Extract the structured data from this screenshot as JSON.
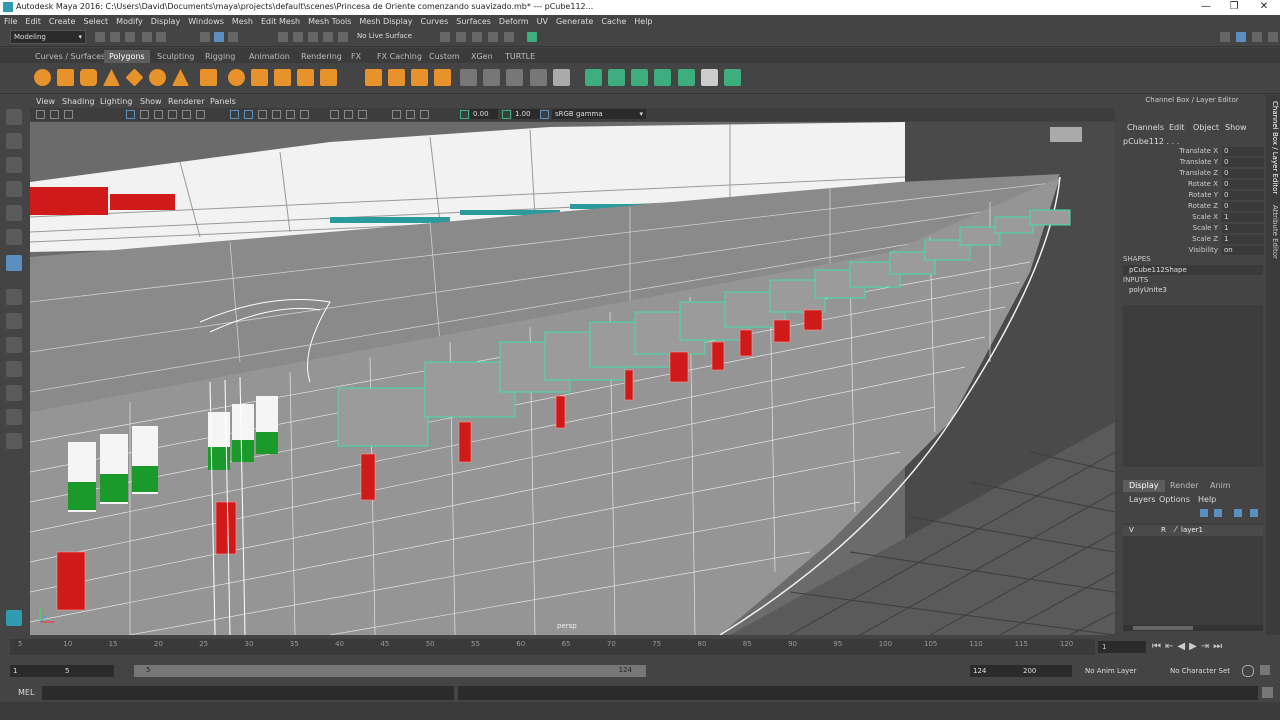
{
  "window": {
    "title": "Autodesk Maya 2016: C:\\Users\\David\\Documents\\maya\\projects\\default\\scenes\\Princesa de Oriente comenzando suavizado.mb*   ---   pCube112..."
  },
  "menubar": {
    "items": [
      "File",
      "Edit",
      "Create",
      "Select",
      "Modify",
      "Display",
      "Windows",
      "Mesh",
      "Edit Mesh",
      "Mesh Tools",
      "Mesh Display",
      "Curves",
      "Surfaces",
      "Deform",
      "UV",
      "Generate",
      "Cache",
      "Help"
    ]
  },
  "statusline": {
    "mode": "Modeling",
    "live_surface": "No Live Surface"
  },
  "shelf": {
    "tabs": [
      "Curves / Surfaces",
      "Polygons",
      "Sculpting",
      "Rigging",
      "Animation",
      "Rendering",
      "FX",
      "FX Caching",
      "Custom",
      "XGen",
      "TURTLE"
    ],
    "active_tab": "Polygons"
  },
  "panel": {
    "menu": [
      "View",
      "Shading",
      "Lighting",
      "Show",
      "Renderer",
      "Panels"
    ],
    "near_value": "0.00",
    "far_value": "1.00",
    "color_space": "sRGB gamma",
    "camera_label": "persp"
  },
  "channel_box": {
    "title": "Channel Box / Layer Editor",
    "menu": [
      "Channels",
      "Edit",
      "Object",
      "Show"
    ],
    "object": "pCube112 . . .",
    "attributes": [
      {
        "name": "Translate X",
        "value": "0"
      },
      {
        "name": "Translate Y",
        "value": "0"
      },
      {
        "name": "Translate Z",
        "value": "0"
      },
      {
        "name": "Rotate X",
        "value": "0"
      },
      {
        "name": "Rotate Y",
        "value": "0"
      },
      {
        "name": "Rotate Z",
        "value": "0"
      },
      {
        "name": "Scale X",
        "value": "1"
      },
      {
        "name": "Scale Y",
        "value": "1"
      },
      {
        "name": "Scale Z",
        "value": "1"
      },
      {
        "name": "Visibility",
        "value": "on"
      }
    ],
    "shapes_header": "SHAPES",
    "shape": "pCube112Shape",
    "inputs_header": "INPUTS",
    "input": "polyUnite3"
  },
  "layer_editor": {
    "tabs": [
      "Display",
      "Render",
      "Anim"
    ],
    "active_tab": "Display",
    "menu": [
      "Layers",
      "Options",
      "Help"
    ],
    "layer": {
      "v": "V",
      "r": "R",
      "name": "layer1"
    }
  },
  "side_tabs": [
    "Channel Box / Layer Editor",
    "Attribute Editor"
  ],
  "timeline": {
    "ticks": [
      "5",
      "10",
      "15",
      "20",
      "25",
      "30",
      "35",
      "40",
      "45",
      "50",
      "55",
      "60",
      "65",
      "70",
      "75",
      "80",
      "85",
      "90",
      "95",
      "100",
      "105",
      "110",
      "115",
      "120"
    ],
    "current_frame": "1"
  },
  "range": {
    "start": "1",
    "playback_start": "5",
    "slider_start": "5",
    "slider_end": "124",
    "playback_end": "124",
    "end": "200",
    "anim_layer": "No Anim Layer",
    "character_set": "No Character Set"
  },
  "command_line": {
    "label": "MEL"
  },
  "colors": {
    "accent": "#5d5d5d",
    "poly_icon": "#e8922c",
    "green_icon": "#3fae7e",
    "selection": "#44e0a8",
    "lifeboat_red": "#d01a1a",
    "hull_green": "#1a9a2a"
  }
}
